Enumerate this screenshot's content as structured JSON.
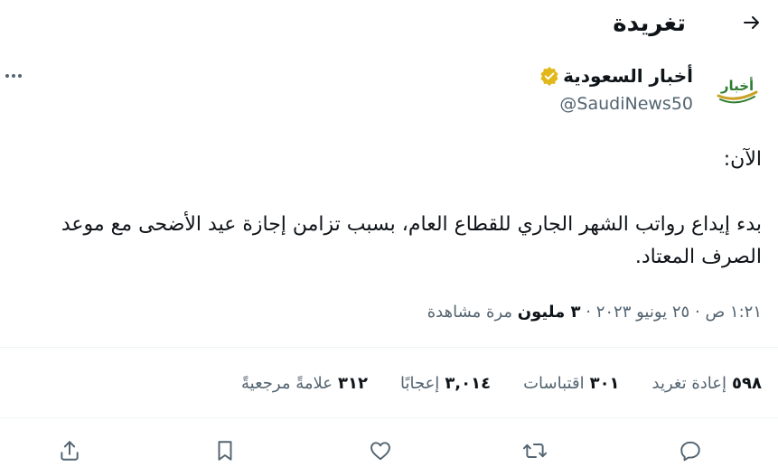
{
  "header": {
    "title": "تغريدة",
    "back_icon": "arrow-right-icon"
  },
  "author": {
    "display_name": "أخبار السعودية",
    "handle": "@SaudiNews50",
    "verified_icon": "gold-verified-badge-icon",
    "avatar_logo_text": "أخبار",
    "brand_colors": {
      "green": "#2e7d32",
      "gold": "#c9a227"
    }
  },
  "tweet": {
    "line1": "الآن:",
    "line2": "بدء إيداع رواتب الشهر الجاري للقطاع العام، بسبب تزامن إجازة عيد الأضحى مع موعد الصرف المعتاد."
  },
  "meta": {
    "time": "١:٢١ ص",
    "date": "٢٥ يونيو ٢٠٢٣",
    "views_count": "٣ مليون",
    "views_label": "مرة مشاهدة",
    "separator": "·"
  },
  "stats": [
    {
      "count": "٥٩٨",
      "label": "إعادة تغريد"
    },
    {
      "count": "٣٠١",
      "label": "اقتباسات"
    },
    {
      "count": "٣,٠١٤",
      "label": "إعجابًا"
    },
    {
      "count": "٣١٢",
      "label": "علامةً مرجعيةً"
    }
  ],
  "actions": [
    "reply-icon",
    "retweet-icon",
    "like-icon",
    "bookmark-icon",
    "share-icon"
  ],
  "colors": {
    "text": "#0f1419",
    "secondary": "#536471",
    "divider": "#eff3f4",
    "verified_gold": "#e2b719"
  }
}
